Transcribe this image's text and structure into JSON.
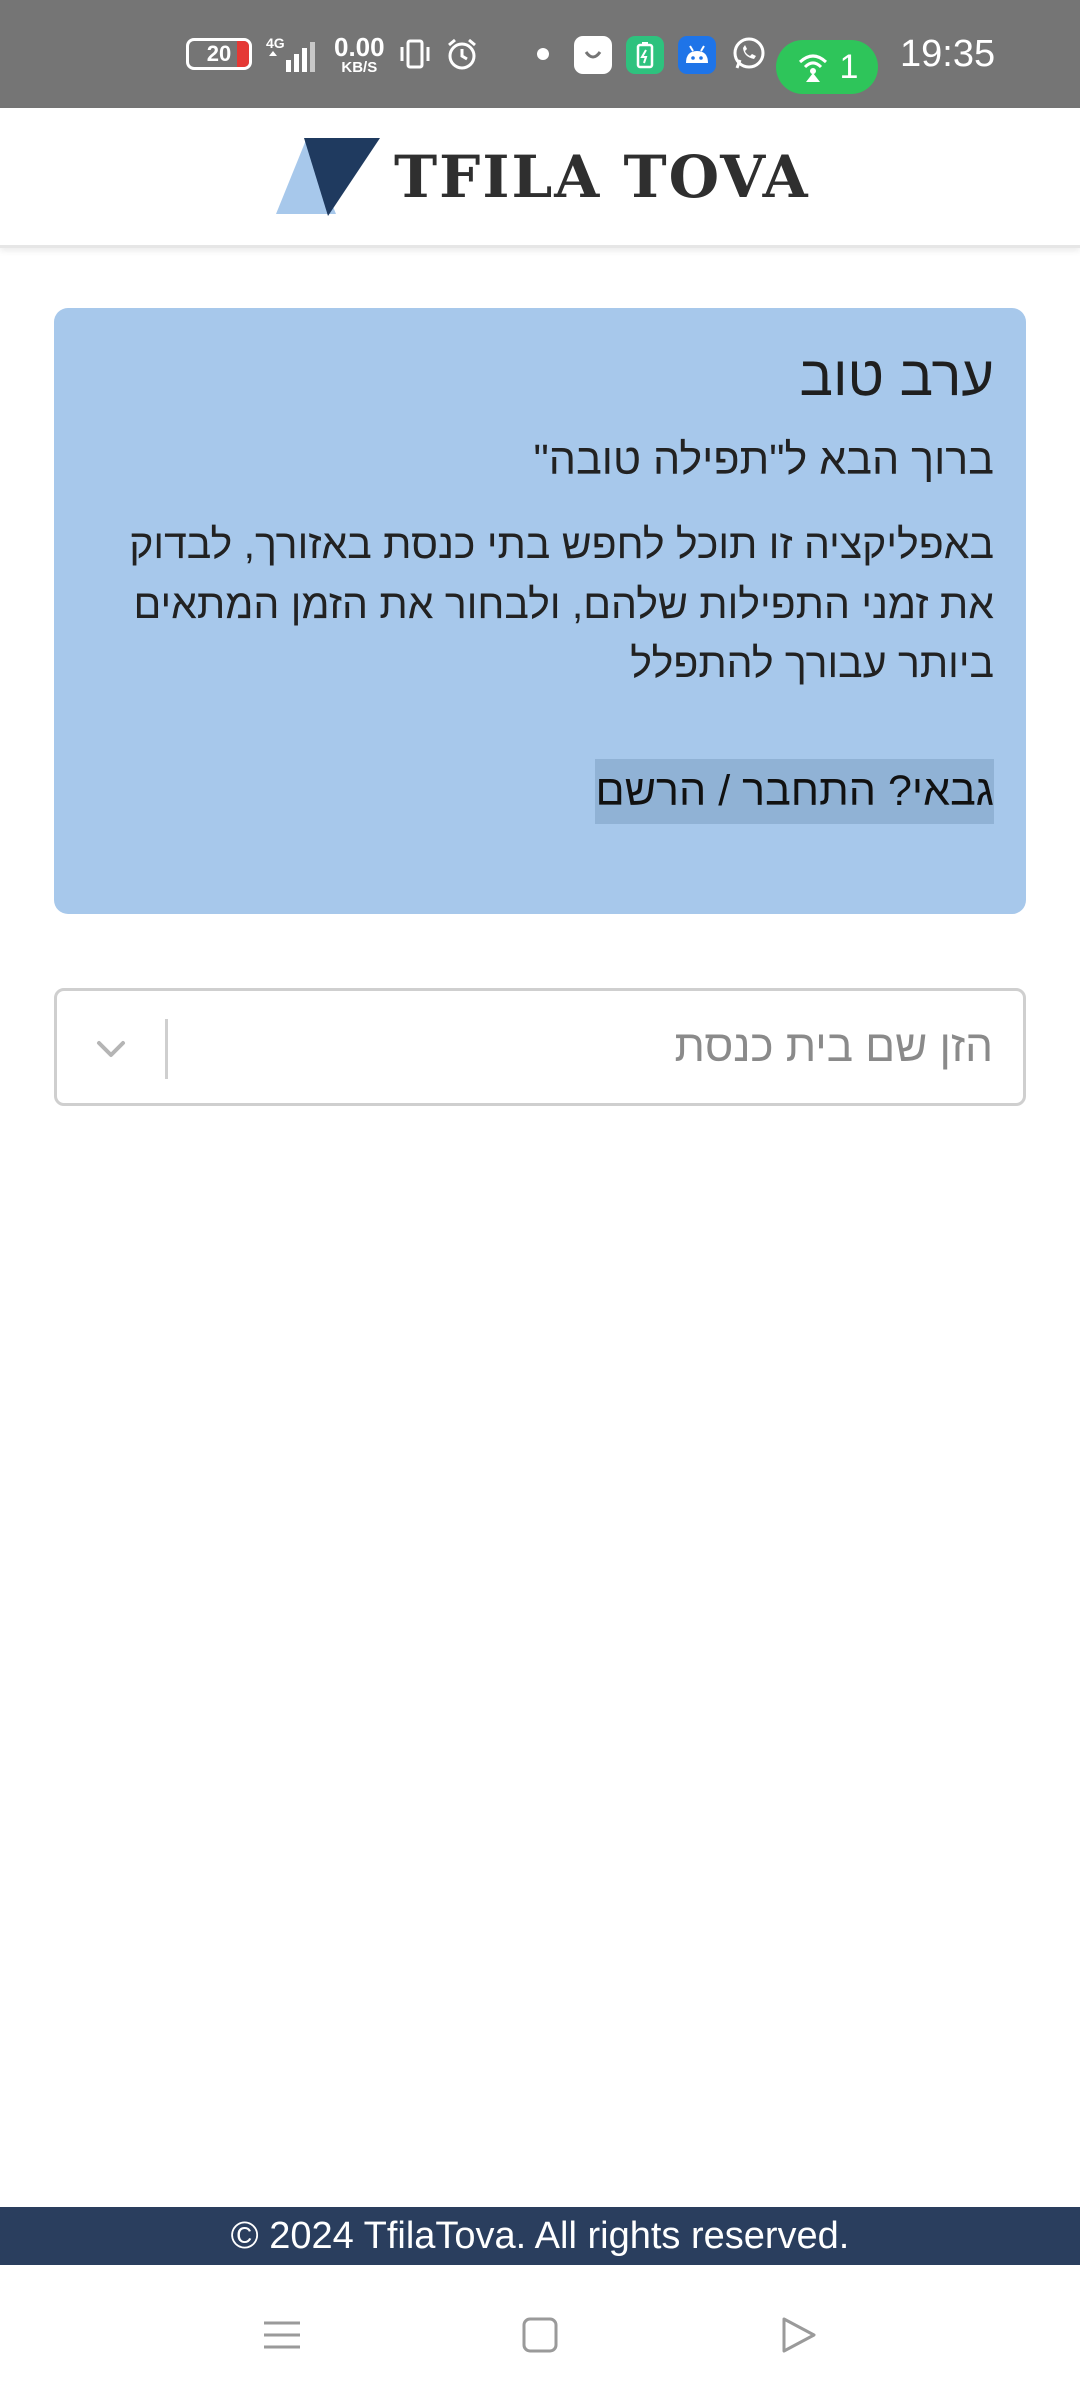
{
  "status_bar": {
    "battery_level": "20",
    "network_type": "4G",
    "speed_value": "0.00",
    "speed_unit": "KB/S",
    "hotspot_count": "1",
    "time": "19:35",
    "icons": [
      "battery-icon",
      "signal-4g-icon",
      "vibrate-icon",
      "alarm-icon",
      "notification-dot-icon",
      "app-icon",
      "battery-app-icon",
      "android-icon",
      "whatsapp-icon",
      "hotspot-icon"
    ]
  },
  "header": {
    "logo_text": "TFILA TOVA",
    "colors": {
      "light_triangle": "#a7c8eb",
      "dark_triangle": "#1f3a5f"
    }
  },
  "welcome": {
    "greeting": "ערב טוב",
    "subtitle": "ברוך הבא ל\"תפילה טובה\"",
    "description": "באפליקציה זו תוכל לחפש בתי כנסת באזורך, לבדוק את זמני התפילות שלהם, ולבחור את הזמן המתאים ביותר עבורך להתפלל",
    "gabai_link": "גבאי? התחבר / הרשם",
    "background_color": "#a7c8eb"
  },
  "search": {
    "placeholder": "הזן שם בית כנסת"
  },
  "footer": {
    "text": "© 2024 TfilaTova. All rights reserved.",
    "background_color": "#2a3e5e"
  },
  "nav": {
    "icons": [
      "menu-icon",
      "home-icon",
      "back-icon"
    ]
  }
}
